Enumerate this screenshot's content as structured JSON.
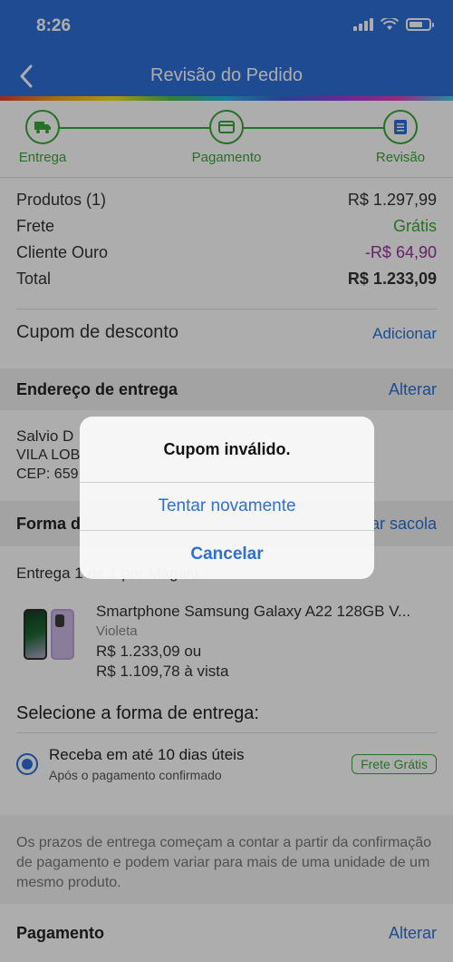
{
  "status_bar": {
    "time": "8:26"
  },
  "nav": {
    "title": "Revisão do Pedido"
  },
  "steps": [
    {
      "label": "Entrega",
      "icon": "truck-icon"
    },
    {
      "label": "Pagamento",
      "icon": "card-icon"
    },
    {
      "label": "Revisão",
      "icon": "document-icon"
    }
  ],
  "summary": {
    "products_label": "Produtos (1)",
    "products_value": "R$ 1.297,99",
    "shipping_label": "Frete",
    "shipping_value": "Grátis",
    "gold_label": "Cliente Ouro",
    "gold_value": "-R$ 64,90",
    "total_label": "Total",
    "total_value": "R$ 1.233,09"
  },
  "coupon": {
    "label": "Cupom de desconto",
    "action": "Adicionar"
  },
  "address": {
    "header": "Endereço de entrega",
    "action": "Alterar",
    "name": "Salvio D",
    "line1": "VILA LOB",
    "cep": "CEP: 659"
  },
  "delivery_form": {
    "label": "Forma d",
    "action": "ar sacola"
  },
  "delivery_title": "Entrega 1 de 1 por Magalu",
  "product": {
    "name": "Smartphone Samsung Galaxy A22 128GB V...",
    "color": "Violeta",
    "price_installments": "R$ 1.233,09 ou",
    "price_cash": "R$ 1.109,78 à vista"
  },
  "shipping": {
    "select_title": "Selecione a forma de entrega:",
    "option_title": "Receba em até 10 dias úteis",
    "option_subtitle": "Após o pagamento confirmado",
    "badge": "Frete Grátis"
  },
  "note": "Os prazos de entrega começam a contar a partir da confirmação de pagamento e podem variar para mais de uma unidade de um mesmo produto.",
  "payment": {
    "label": "Pagamento",
    "action": "Alterar"
  },
  "alert": {
    "title": "Cupom inválido.",
    "retry": "Tentar novamente",
    "cancel": "Cancelar"
  },
  "colors": {
    "primary": "#2f6fd8",
    "success": "#3aa63a",
    "discount": "#9b2f9b"
  }
}
